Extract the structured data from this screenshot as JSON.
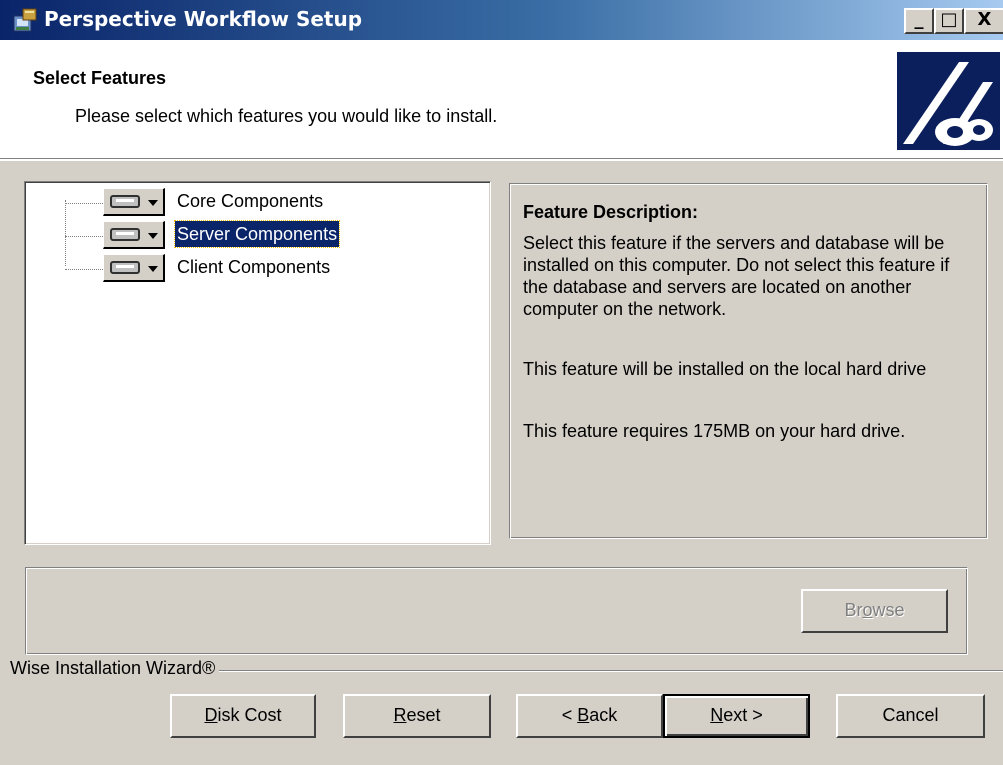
{
  "window": {
    "title": "Perspective Workflow Setup",
    "controls": {
      "minimize": "_",
      "maximize": "□",
      "close": "X"
    }
  },
  "header": {
    "title": "Select Features",
    "subtitle": "Please select which features you would like to install."
  },
  "features": [
    {
      "label": "Core Components",
      "icon": "hard-drive-icon",
      "selected": false
    },
    {
      "label": "Server Components",
      "icon": "hard-drive-icon",
      "selected": true
    },
    {
      "label": "Client Components",
      "icon": "hard-drive-icon",
      "selected": false
    }
  ],
  "description": {
    "title": "Feature Description:",
    "text": "Select this feature if the servers and database will be installed on this computer. Do not select this feature if the database and servers are located on another computer on the network.",
    "status": "This feature will be installed on the local hard drive",
    "requirement": "This feature requires 175MB on your hard drive."
  },
  "path": {
    "browse_prefix": "Br",
    "browse_underlined": "o",
    "browse_suffix": "wse"
  },
  "footer": {
    "brand": "Wise Installation Wizard®",
    "buttons": {
      "disk_cost": {
        "underlined": "D",
        "rest": "isk Cost"
      },
      "reset": {
        "underlined": "R",
        "rest": "eset"
      },
      "back": {
        "prefix": "< ",
        "underlined": "B",
        "rest": "ack"
      },
      "next": {
        "underlined": "N",
        "rest": "ext >"
      },
      "cancel": "Cancel"
    }
  },
  "colors": {
    "titlebar_start": "#0a246a",
    "titlebar_end": "#a6caf0",
    "dialog_bg": "#d4d0c8",
    "selection": "#0a246a"
  }
}
